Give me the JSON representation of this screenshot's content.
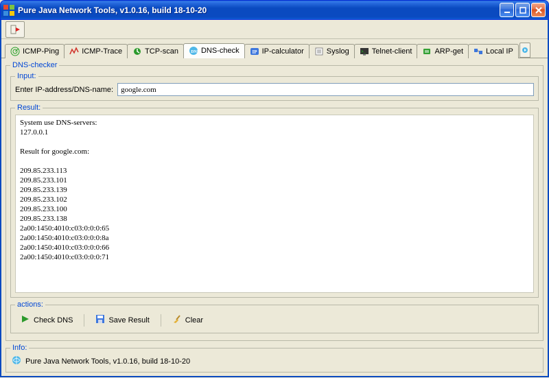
{
  "window": {
    "title": "Pure Java Network Tools,  v1.0.16, build 18-10-20"
  },
  "tabs": [
    {
      "label": "ICMP-Ping",
      "icon": "radar-icon",
      "active": false
    },
    {
      "label": "ICMP-Trace",
      "icon": "trace-icon",
      "active": false
    },
    {
      "label": "TCP-scan",
      "icon": "scan-icon",
      "active": false
    },
    {
      "label": "DNS-check",
      "icon": "dns-icon",
      "active": true
    },
    {
      "label": "IP-calculator",
      "icon": "ipcalc-icon",
      "active": false
    },
    {
      "label": "Syslog",
      "icon": "syslog-icon",
      "active": false
    },
    {
      "label": "Telnet-client",
      "icon": "telnet-icon",
      "active": false
    },
    {
      "label": "ARP-get",
      "icon": "arp-icon",
      "active": false
    },
    {
      "label": "Local IP",
      "icon": "localip-icon",
      "active": false
    }
  ],
  "dns_checker": {
    "group_label": "DNS-checker",
    "input_group": "Input:",
    "input_label": "Enter IP-address/DNS-name:",
    "input_value": "google.com",
    "result_group": "Result:",
    "result_text": "System use DNS-servers:\n127.0.0.1\n\nResult for google.com:\n\n209.85.233.113\n209.85.233.101\n209.85.233.139\n209.85.233.102\n209.85.233.100\n209.85.233.138\n2a00:1450:4010:c03:0:0:0:65\n2a00:1450:4010:c03:0:0:0:8a\n2a00:1450:4010:c03:0:0:0:66\n2a00:1450:4010:c03:0:0:0:71\n"
  },
  "actions": {
    "group_label": "actions:",
    "check_label": "Check DNS",
    "save_label": "Save Result",
    "clear_label": "Clear"
  },
  "info": {
    "group_label": "Info:",
    "text": "Pure Java Network Tools,  v1.0.16, build 18-10-20"
  }
}
